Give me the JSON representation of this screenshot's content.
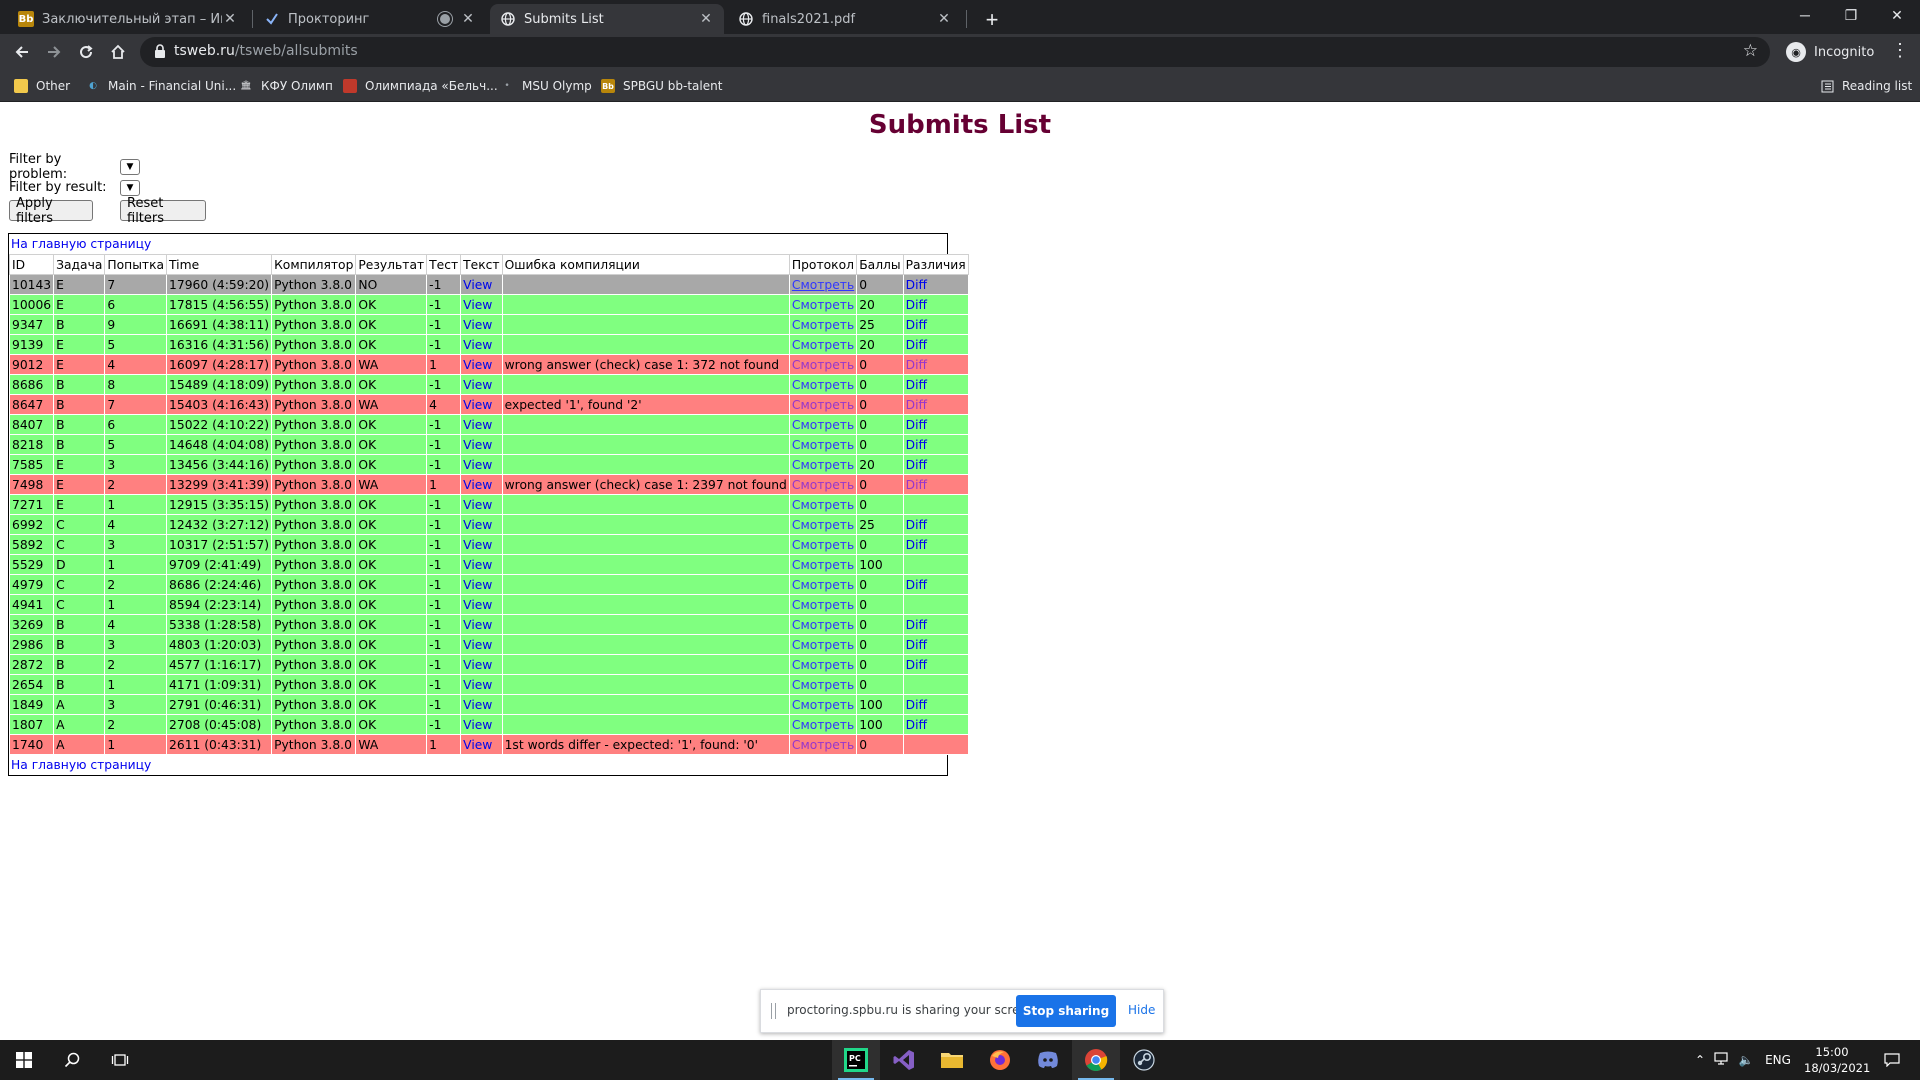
{
  "browser": {
    "tabs": [
      {
        "title": "Заключительный этап – Инфор",
        "favicon": "Bb"
      },
      {
        "title": "Прокторинг",
        "favicon": "proctor-icon"
      },
      {
        "title": "Submits List",
        "favicon": "globe-icon"
      },
      {
        "title": "finals2021.pdf",
        "favicon": "globe-icon"
      }
    ],
    "url_host": "tsweb.ru",
    "url_path": "/tsweb/allsubmits",
    "profile_label": "Incognito",
    "reading_list": "Reading list",
    "bookmarks": [
      {
        "label": "Other"
      },
      {
        "label": "Main - Financial Uni..."
      },
      {
        "label": "КФУ Олимп"
      },
      {
        "label": "Олимпиада «Бельч..."
      },
      {
        "label": "MSU Olymp"
      },
      {
        "label": "SPBGU bb-talent"
      }
    ]
  },
  "page": {
    "title": "Submits List",
    "filter_problem_label": "Filter by problem:",
    "filter_result_label": "Filter by result:",
    "apply_label": "Apply filters",
    "reset_label": "Reset filters",
    "home_link": "На главную страницу",
    "columns": [
      "ID",
      "Задача",
      "Попытка",
      "Time",
      "Компилятор",
      "Результат",
      "Тест",
      "Текст",
      "Ошибка компиляции",
      "Протокол",
      "Баллы",
      "Различия"
    ],
    "view_label": "View",
    "protocol_label": "Смотреть",
    "diff_label": "Diff",
    "rows": [
      {
        "id": "10143",
        "task": "E",
        "attempt": "7",
        "time": "17960 (4:59:20)",
        "compiler": "Python 3.8.0",
        "result": "NO",
        "test": "-1",
        "error": "",
        "score": "0",
        "diff": true
      },
      {
        "id": "10006",
        "task": "E",
        "attempt": "6",
        "time": "17815 (4:56:55)",
        "compiler": "Python 3.8.0",
        "result": "OK",
        "test": "-1",
        "error": "",
        "score": "20",
        "diff": true
      },
      {
        "id": "9347",
        "task": "B",
        "attempt": "9",
        "time": "16691 (4:38:11)",
        "compiler": "Python 3.8.0",
        "result": "OK",
        "test": "-1",
        "error": "",
        "score": "25",
        "diff": true
      },
      {
        "id": "9139",
        "task": "E",
        "attempt": "5",
        "time": "16316 (4:31:56)",
        "compiler": "Python 3.8.0",
        "result": "OK",
        "test": "-1",
        "error": "",
        "score": "20",
        "diff": true
      },
      {
        "id": "9012",
        "task": "E",
        "attempt": "4",
        "time": "16097 (4:28:17)",
        "compiler": "Python 3.8.0",
        "result": "WA",
        "test": "1",
        "error": "wrong answer (check) case 1: 372 not found",
        "score": "0",
        "diff": true
      },
      {
        "id": "8686",
        "task": "B",
        "attempt": "8",
        "time": "15489 (4:18:09)",
        "compiler": "Python 3.8.0",
        "result": "OK",
        "test": "-1",
        "error": "",
        "score": "0",
        "diff": true
      },
      {
        "id": "8647",
        "task": "B",
        "attempt": "7",
        "time": "15403 (4:16:43)",
        "compiler": "Python 3.8.0",
        "result": "WA",
        "test": "4",
        "error": "expected '1', found '2'",
        "score": "0",
        "diff": true
      },
      {
        "id": "8407",
        "task": "B",
        "attempt": "6",
        "time": "15022 (4:10:22)",
        "compiler": "Python 3.8.0",
        "result": "OK",
        "test": "-1",
        "error": "",
        "score": "0",
        "diff": true
      },
      {
        "id": "8218",
        "task": "B",
        "attempt": "5",
        "time": "14648 (4:04:08)",
        "compiler": "Python 3.8.0",
        "result": "OK",
        "test": "-1",
        "error": "",
        "score": "0",
        "diff": true
      },
      {
        "id": "7585",
        "task": "E",
        "attempt": "3",
        "time": "13456 (3:44:16)",
        "compiler": "Python 3.8.0",
        "result": "OK",
        "test": "-1",
        "error": "",
        "score": "20",
        "diff": true
      },
      {
        "id": "7498",
        "task": "E",
        "attempt": "2",
        "time": "13299 (3:41:39)",
        "compiler": "Python 3.8.0",
        "result": "WA",
        "test": "1",
        "error": "wrong answer (check) case 1: 2397 not found",
        "score": "0",
        "diff": true
      },
      {
        "id": "7271",
        "task": "E",
        "attempt": "1",
        "time": "12915 (3:35:15)",
        "compiler": "Python 3.8.0",
        "result": "OK",
        "test": "-1",
        "error": "",
        "score": "0",
        "diff": false
      },
      {
        "id": "6992",
        "task": "C",
        "attempt": "4",
        "time": "12432 (3:27:12)",
        "compiler": "Python 3.8.0",
        "result": "OK",
        "test": "-1",
        "error": "",
        "score": "25",
        "diff": true
      },
      {
        "id": "5892",
        "task": "C",
        "attempt": "3",
        "time": "10317 (2:51:57)",
        "compiler": "Python 3.8.0",
        "result": "OK",
        "test": "-1",
        "error": "",
        "score": "0",
        "diff": true
      },
      {
        "id": "5529",
        "task": "D",
        "attempt": "1",
        "time": "9709 (2:41:49)",
        "compiler": "Python 3.8.0",
        "result": "OK",
        "test": "-1",
        "error": "",
        "score": "100",
        "diff": false
      },
      {
        "id": "4979",
        "task": "C",
        "attempt": "2",
        "time": "8686 (2:24:46)",
        "compiler": "Python 3.8.0",
        "result": "OK",
        "test": "-1",
        "error": "",
        "score": "0",
        "diff": true
      },
      {
        "id": "4941",
        "task": "C",
        "attempt": "1",
        "time": "8594 (2:23:14)",
        "compiler": "Python 3.8.0",
        "result": "OK",
        "test": "-1",
        "error": "",
        "score": "0",
        "diff": false
      },
      {
        "id": "3269",
        "task": "B",
        "attempt": "4",
        "time": "5338 (1:28:58)",
        "compiler": "Python 3.8.0",
        "result": "OK",
        "test": "-1",
        "error": "",
        "score": "0",
        "diff": true
      },
      {
        "id": "2986",
        "task": "B",
        "attempt": "3",
        "time": "4803 (1:20:03)",
        "compiler": "Python 3.8.0",
        "result": "OK",
        "test": "-1",
        "error": "",
        "score": "0",
        "diff": true
      },
      {
        "id": "2872",
        "task": "B",
        "attempt": "2",
        "time": "4577 (1:16:17)",
        "compiler": "Python 3.8.0",
        "result": "OK",
        "test": "-1",
        "error": "",
        "score": "0",
        "diff": true
      },
      {
        "id": "2654",
        "task": "B",
        "attempt": "1",
        "time": "4171 (1:09:31)",
        "compiler": "Python 3.8.0",
        "result": "OK",
        "test": "-1",
        "error": "",
        "score": "0",
        "diff": false
      },
      {
        "id": "1849",
        "task": "A",
        "attempt": "3",
        "time": "2791 (0:46:31)",
        "compiler": "Python 3.8.0",
        "result": "OK",
        "test": "-1",
        "error": "",
        "score": "100",
        "diff": true
      },
      {
        "id": "1807",
        "task": "A",
        "attempt": "2",
        "time": "2708 (0:45:08)",
        "compiler": "Python 3.8.0",
        "result": "OK",
        "test": "-1",
        "error": "",
        "score": "100",
        "diff": true
      },
      {
        "id": "1740",
        "task": "A",
        "attempt": "1",
        "time": "2611 (0:43:31)",
        "compiler": "Python 3.8.0",
        "result": "WA",
        "test": "1",
        "error": "1st words differ - expected: '1', found: '0'",
        "score": "0",
        "diff": false
      }
    ],
    "result_colors": {
      "NO": "#a8a8a8",
      "OK": "#80ff80",
      "WA": "#ff8080"
    },
    "title_color": "#660033"
  },
  "sharing": {
    "message": "proctoring.spbu.ru is sharing your screen.",
    "stop_label": "Stop sharing",
    "hide_label": "Hide"
  },
  "taskbar": {
    "lang": "ENG",
    "time": "15:00",
    "date": "18/03/2021"
  }
}
